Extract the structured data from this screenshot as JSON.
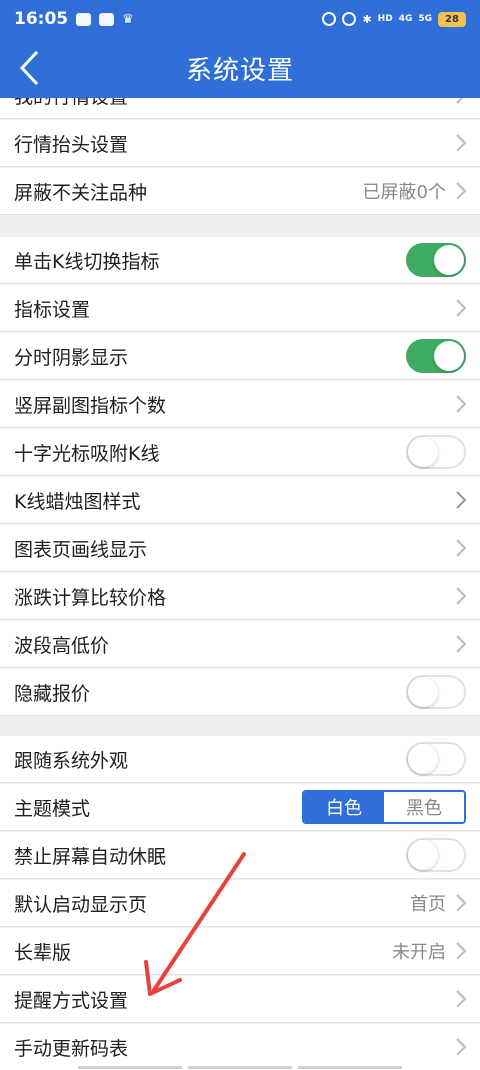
{
  "status_bar": {
    "time": "16:05",
    "hd_label": "HD",
    "signal_label": "4G",
    "signal_label_2": "5G",
    "battery": "28"
  },
  "nav": {
    "title": "系统设置"
  },
  "rows": [
    {
      "label": "我的行情设置"
    },
    {
      "label": "行情抬头设置"
    },
    {
      "label": "屏蔽不关注品种",
      "value": "已屏蔽0个"
    },
    {
      "label": "单击K线切换指标"
    },
    {
      "label": "指标设置"
    },
    {
      "label": "分时阴影显示"
    },
    {
      "label": "竖屏副图指标个数"
    },
    {
      "label": "十字光标吸附K线"
    },
    {
      "label": "K线蜡烛图样式"
    },
    {
      "label": "图表页画线显示"
    },
    {
      "label": "涨跌计算比较价格"
    },
    {
      "label": "波段高低价"
    },
    {
      "label": "隐藏报价"
    },
    {
      "label": "跟随系统外观"
    },
    {
      "label": "主题模式"
    },
    {
      "label": "禁止屏幕自动休眠"
    },
    {
      "label": "默认启动显示页",
      "value": "首页"
    },
    {
      "label": "长辈版",
      "value": "未开启"
    },
    {
      "label": "提醒方式设置"
    },
    {
      "label": "手动更新码表"
    }
  ],
  "theme_mode": {
    "options": [
      "白色",
      "黑色"
    ],
    "selected": "白色"
  },
  "toggles": {
    "kline_switch_indicator": true,
    "intraday_shadow": true,
    "crosshair_snap": false,
    "hide_quote": false,
    "follow_system": false,
    "no_sleep": false
  },
  "colors": {
    "primary": "#2f6fd7",
    "toggle_on": "#3dab62",
    "annotation_arrow": "#e8413c"
  }
}
